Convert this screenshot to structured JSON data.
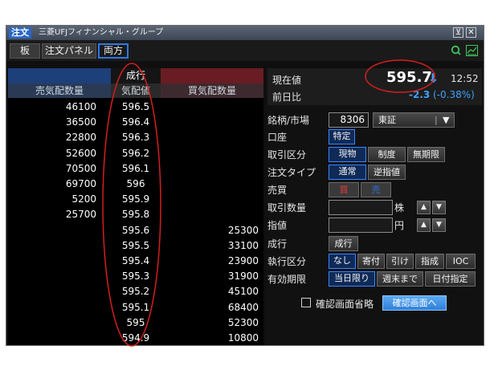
{
  "window": {
    "badge": "注文",
    "title": "三菱UFJフィナンシャル・グループ",
    "minimize_icon": "minimize-icon",
    "close_icon": "close-icon"
  },
  "tabs": [
    {
      "label": "板"
    },
    {
      "label": "注文パネル"
    },
    {
      "label": "両方",
      "active": true
    }
  ],
  "toolbar_icons": [
    "search-icon",
    "chart-icon"
  ],
  "board": {
    "market_order_label": "成行",
    "headers": {
      "sell_qty": "売気配数量",
      "price": "気配値",
      "buy_qty": "買気配数量"
    },
    "rows": [
      {
        "sell": "46100",
        "price": "596.5",
        "buy": ""
      },
      {
        "sell": "36500",
        "price": "596.4",
        "buy": ""
      },
      {
        "sell": "22800",
        "price": "596.3",
        "buy": ""
      },
      {
        "sell": "52600",
        "price": "596.2",
        "buy": ""
      },
      {
        "sell": "70500",
        "price": "596.1",
        "buy": ""
      },
      {
        "sell": "69700",
        "price": "596",
        "buy": ""
      },
      {
        "sell": "5200",
        "price": "595.9",
        "buy": ""
      },
      {
        "sell": "25700",
        "price": "595.8",
        "buy": ""
      },
      {
        "sell": "",
        "price": "595.6",
        "buy": "25300"
      },
      {
        "sell": "",
        "price": "595.5",
        "buy": "33100"
      },
      {
        "sell": "",
        "price": "595.4",
        "buy": "23900"
      },
      {
        "sell": "",
        "price": "595.3",
        "buy": "31900"
      },
      {
        "sell": "",
        "price": "595.2",
        "buy": "45100"
      },
      {
        "sell": "",
        "price": "595.1",
        "buy": "68400"
      },
      {
        "sell": "",
        "price": "595",
        "buy": "52300"
      },
      {
        "sell": "",
        "price": "594.9",
        "buy": "10800"
      }
    ]
  },
  "quote": {
    "current_label": "現在値",
    "current_value": "595.7",
    "trend_icon": "arrow-down-icon",
    "time": "12:52",
    "change_label": "前日比",
    "change_value": "-2.3",
    "change_pct": "(-0.38%)"
  },
  "order": {
    "symbol_label": "銘柄/市場",
    "symbol_value": "8306",
    "market_value": "東証",
    "account_label": "口座",
    "account_value": "特定",
    "trade_type_label": "取引区分",
    "trade_types": [
      "現物",
      "制度",
      "無期限"
    ],
    "order_type_label": "注文タイプ",
    "order_types": [
      "通常",
      "逆指値"
    ],
    "side_label": "売買",
    "side_buy": "買",
    "side_sell": "売",
    "qty_label": "取引数量",
    "qty_unit": "株",
    "price_label": "指値",
    "price_unit": "円",
    "market_label": "成行",
    "market_button": "成行",
    "exec_label": "執行区分",
    "exec_options": [
      "なし",
      "寄付",
      "引け",
      "指成",
      "IOC"
    ],
    "validity_label": "有効期限",
    "validity_options": [
      "当日限り",
      "週末まで",
      "日付指定"
    ],
    "skip_confirm_label": "確認画面省略",
    "confirm_button": "確認画面へ"
  },
  "colors": {
    "accent": "#2f78e6",
    "buy_red": "#e23a3a",
    "sell_blue": "#2f6fd6",
    "change_blue": "#3fa0ff",
    "annotation_red": "#d41e1e"
  }
}
